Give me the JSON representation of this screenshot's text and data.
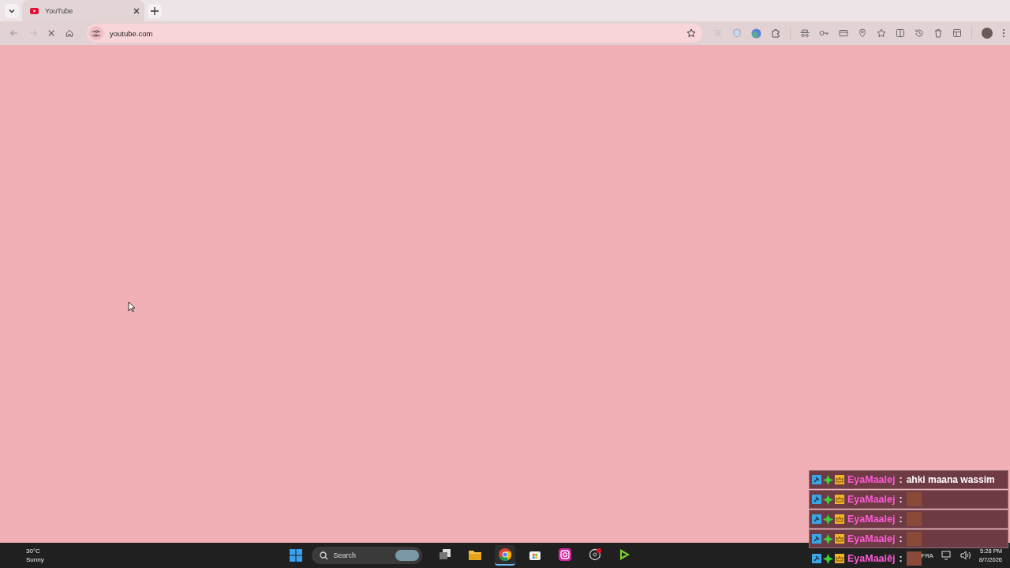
{
  "tabs": [
    {
      "title": "YouTube",
      "selected": true
    }
  ],
  "toolbar": {
    "address": "youtube.com",
    "loading": true
  },
  "chat": {
    "messages": [
      {
        "user": "EyaMaalej",
        "separator": ":",
        "kind": "text",
        "text": "ahki maana wassim"
      },
      {
        "user": "EyaMaalej",
        "separator": ":",
        "kind": "emote"
      },
      {
        "user": "EyaMaalej",
        "separator": ":",
        "kind": "emote"
      },
      {
        "user": "EyaMaalej",
        "separator": ":",
        "kind": "emote"
      },
      {
        "user": "EyaMaalêj",
        "separator": ":",
        "kind": "emote"
      }
    ]
  },
  "taskbar": {
    "weather": {
      "temperature": "30°C",
      "condition": "Sunny"
    },
    "search": {
      "placeholder": "Search"
    },
    "apps": [
      {
        "kind": "taskview",
        "active": false
      },
      {
        "kind": "files",
        "active": false
      },
      {
        "kind": "chrome",
        "active": true
      },
      {
        "kind": "store",
        "active": false
      },
      {
        "kind": "instagram",
        "active": false
      },
      {
        "kind": "obs",
        "active": false
      },
      {
        "kind": "player",
        "active": false
      }
    ],
    "language": "FRA",
    "time": "5:28 PM",
    "date": "8/7/2026"
  }
}
